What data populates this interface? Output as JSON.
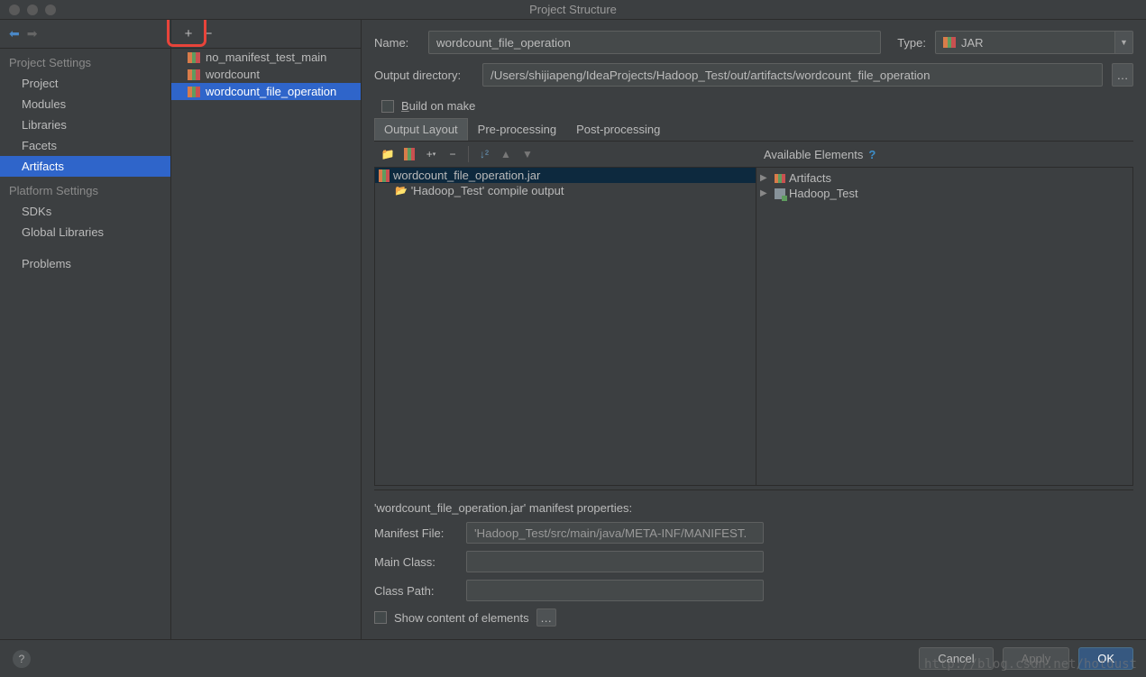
{
  "window": {
    "title": "Project Structure"
  },
  "leftNav": {
    "section1": "Project Settings",
    "items1": [
      "Project",
      "Modules",
      "Libraries",
      "Facets",
      "Artifacts"
    ],
    "section2": "Platform Settings",
    "items2": [
      "SDKs",
      "Global Libraries"
    ],
    "section3": "",
    "items3": [
      "Problems"
    ],
    "selected": "Artifacts"
  },
  "artifactsList": {
    "items": [
      "no_manifest_test_main",
      "wordcount",
      "wordcount_file_operation"
    ],
    "selected": "wordcount_file_operation"
  },
  "form": {
    "nameLabel": "Name:",
    "nameValue": "wordcount_file_operation",
    "typeLabel": "Type:",
    "typeValue": "JAR",
    "outputLabel": "Output directory:",
    "outputValue": "/Users/shijiapeng/IdeaProjects/Hadoop_Test/out/artifacts/wordcount_file_operation",
    "buildOnMake": "Build on make"
  },
  "tabs": {
    "items": [
      "Output Layout",
      "Pre-processing",
      "Post-processing"
    ],
    "active": "Output Layout"
  },
  "tree": {
    "root": "wordcount_file_operation.jar",
    "child": "'Hadoop_Test' compile output"
  },
  "available": {
    "header": "Available Elements",
    "items": [
      "Artifacts",
      "Hadoop_Test"
    ]
  },
  "manifest": {
    "title": "'wordcount_file_operation.jar' manifest properties:",
    "fileLabel": "Manifest File:",
    "fileValue": "'Hadoop_Test/src/main/java/META-INF/MANIFEST.",
    "mainClassLabel": "Main Class:",
    "mainClassValue": "",
    "classPathLabel": "Class Path:",
    "classPathValue": "",
    "showContent": "Show content of elements"
  },
  "buttons": {
    "cancel": "Cancel",
    "apply": "Apply",
    "ok": "OK"
  },
  "watermark": "http://blog.csdn.net/hotdust"
}
